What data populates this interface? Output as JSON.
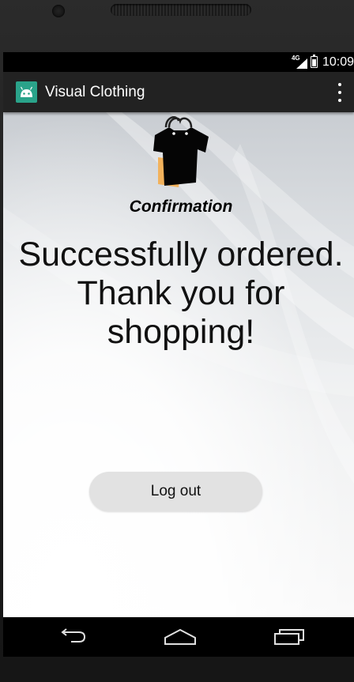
{
  "status_bar": {
    "network": "4G",
    "time": "10:09"
  },
  "app_bar": {
    "title": "Visual Clothing",
    "app_icon": "android-icon",
    "menu_icon": "overflow-menu-icon"
  },
  "confirmation": {
    "heading": "Confirmation",
    "message_line1": "Successfully ordered.",
    "message_line2": "Thank you for",
    "message_line3": "shopping!"
  },
  "actions": {
    "logout_label": "Log out"
  },
  "nav_bar": {
    "back": "back-icon",
    "home": "home-icon",
    "recents": "recents-icon"
  },
  "colors": {
    "app_bar": "#222222",
    "app_icon_bg": "#2aa38a",
    "button_bg": "#e2e2e2"
  }
}
